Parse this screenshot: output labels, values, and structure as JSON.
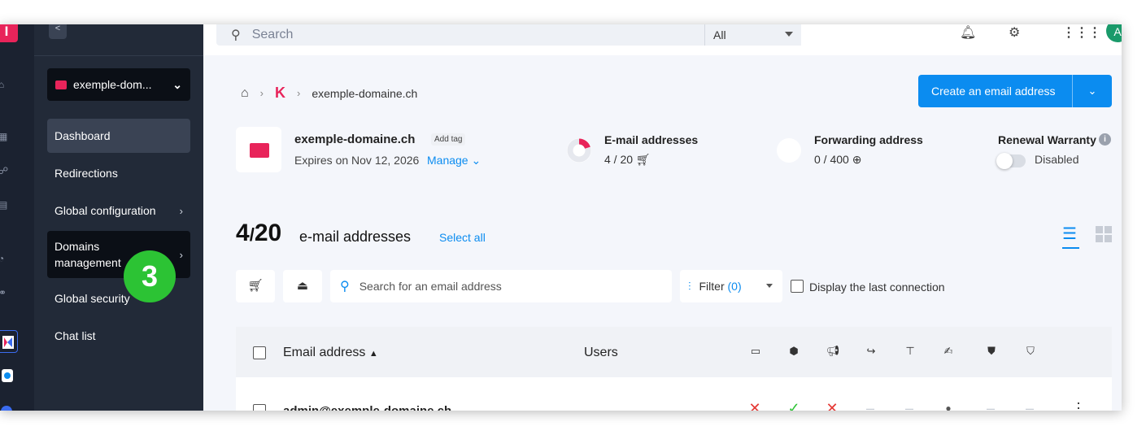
{
  "rail": {
    "logo": "I"
  },
  "sidebar": {
    "collapse_icon": "chevron-left-icon",
    "domain_select": "exemple-dom...",
    "items": [
      {
        "label": "Dashboard",
        "active": true
      },
      {
        "label": "Redirections"
      },
      {
        "label": "Global configuration",
        "has_submenu": true
      },
      {
        "label_line1": "Domains",
        "label_line2": "management",
        "has_submenu": true,
        "highlighted": true
      },
      {
        "label": "Global security"
      },
      {
        "label": "Chat list"
      }
    ],
    "step_badge": "3"
  },
  "topbar": {
    "search_placeholder": "Search",
    "scope_value": "All",
    "avatar": "A"
  },
  "breadcrumb": {
    "current": "exemple-domaine.ch"
  },
  "cta": {
    "label": "Create an email address"
  },
  "domain": {
    "name": "exemple-domaine.ch",
    "add_tag": "Add tag",
    "expires": "Expires on Nov 12, 2026",
    "manage": "Manage"
  },
  "stats": {
    "email_title": "E-mail addresses",
    "email_value": "4 / 20",
    "email_used_fraction": 0.2,
    "forward_title": "Forwarding address",
    "forward_value": "0 / 400",
    "renewal_title": "Renewal Warranty",
    "renewal_value": "Disabled"
  },
  "list": {
    "count_used": "4",
    "count_sep": "/",
    "count_total": "20",
    "count_label": "e-mail addresses",
    "select_all": "Select all"
  },
  "toolbar": {
    "search_placeholder": "Search for an email address",
    "filter_label": "Filter",
    "filter_count": "(0)",
    "display_last": "Display the last connection"
  },
  "table": {
    "col_email": "Email address",
    "col_users": "Users",
    "rows": [
      {
        "email": "admin@exemple-domaine.ch"
      }
    ]
  },
  "colors": {
    "accent": "#0b8cf0",
    "brand": "#e8245a",
    "badge": "#2cc334",
    "sidebar": "#222a38"
  }
}
